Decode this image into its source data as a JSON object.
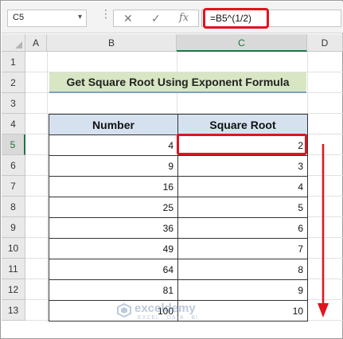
{
  "formula_bar": {
    "name_box": "C5",
    "cancel_symbol": "✕",
    "enter_symbol": "✓",
    "fx_symbol": "fx",
    "formula": "=B5^(1/2)"
  },
  "columns": [
    "A",
    "B",
    "C",
    "D"
  ],
  "rows": [
    "1",
    "2",
    "3",
    "4",
    "5",
    "6",
    "7",
    "8",
    "9",
    "10",
    "11",
    "12",
    "13"
  ],
  "selected": {
    "column": "C",
    "row": "5"
  },
  "sheet": {
    "title": "Get Square Root Using Exponent Formula",
    "headers": [
      "Number",
      "Square Root"
    ],
    "data": [
      [
        "4",
        "2"
      ],
      [
        "9",
        "3"
      ],
      [
        "16",
        "4"
      ],
      [
        "25",
        "5"
      ],
      [
        "36",
        "6"
      ],
      [
        "49",
        "7"
      ],
      [
        "64",
        "8"
      ],
      [
        "81",
        "9"
      ],
      [
        "100",
        "10"
      ]
    ]
  },
  "watermark": {
    "brand": "exceldemy",
    "tagline": "EXCEL · DATA · BI"
  },
  "colors": {
    "highlight": "#e0141e",
    "title_fill": "#d8e6c4",
    "header_fill": "#d6e1f0",
    "excel_green": "#217346"
  }
}
